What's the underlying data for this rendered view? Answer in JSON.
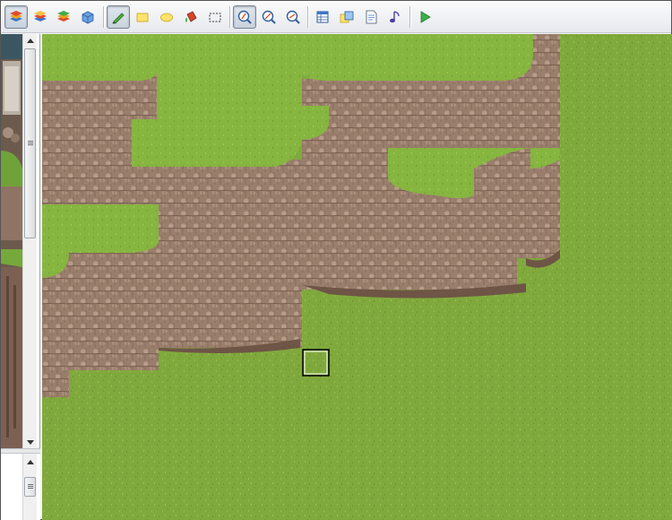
{
  "toolbar": {
    "groups": [
      [
        "layer-1-icon",
        "layer-2-icon",
        "layer-3-icon",
        "event-layer-icon"
      ],
      [
        "pencil-icon",
        "rectangle-icon",
        "ellipse-icon",
        "flood-fill-icon",
        "select-icon"
      ],
      [
        "zoom-1-icon",
        "zoom-2-icon",
        "zoom-4-icon"
      ],
      [
        "database-icon",
        "resource-manager-icon",
        "script-editor-icon",
        "sound-test-icon"
      ],
      [
        "playtest-icon"
      ]
    ]
  },
  "colors": {
    "toolbar_bg": "#eef0f3",
    "grass": "#7fa83c",
    "grass_light": "#8dbb45",
    "cliff": "#9c7f6d",
    "cliff_dark": "#6e5546",
    "selection": "#ffffff"
  },
  "tileset": {
    "label": ""
  },
  "map": {
    "cursor_tile": "selected-tile"
  }
}
